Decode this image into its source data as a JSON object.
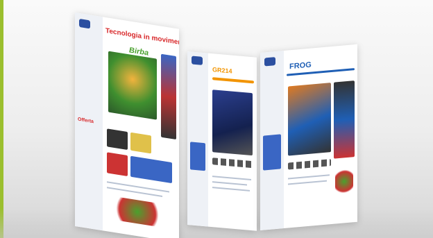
{
  "panels": [
    {
      "heading": "Tecnologia in movimento",
      "brand": "Birba",
      "promo": "Offerta"
    },
    {
      "heading": "GR214"
    },
    {
      "heading": "FROG"
    }
  ],
  "colors": {
    "accent": "#9bbf2e",
    "heading_red": "#d8292b",
    "heading_orange": "#f29400",
    "heading_blue": "#1f5fb5"
  }
}
